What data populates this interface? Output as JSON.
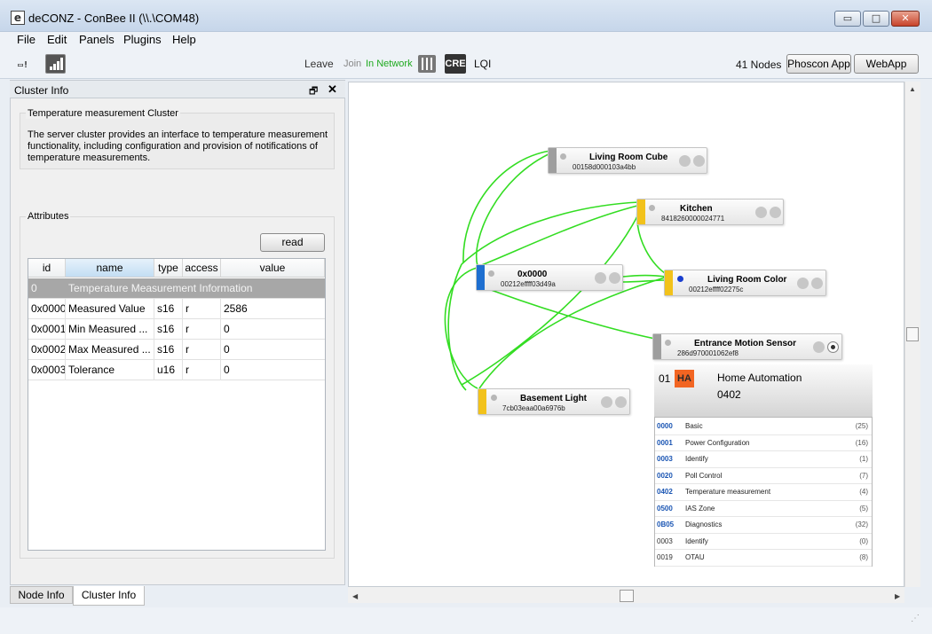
{
  "window": {
    "title": "deCONZ - ConBee II (\\\\.\\COM48)",
    "icon_letter": "e",
    "minimize": "▭",
    "maximize": "□",
    "close": "✕"
  },
  "menu": [
    "File",
    "Edit",
    "Panels",
    "Plugins",
    "Help"
  ],
  "toolbar": {
    "plug_glyph": "▭!",
    "leave": "Leave",
    "join": "Join",
    "network": "In Network",
    "cre": "CRE",
    "lqi": "LQI",
    "nodes": "41 Nodes",
    "phoscon": "Phoscon App",
    "webapp": "WebApp"
  },
  "panel": {
    "title": "Cluster Info",
    "float_glyph": "🗗",
    "close_glyph": "✕",
    "cluster_title": "Temperature measurement Cluster",
    "cluster_desc": "The server cluster provides an interface to temperature measurement functionality, including configuration and provision  of notifications of temperature measurements.",
    "attributes_label": "Attributes",
    "read_button": "read",
    "columns": [
      "id",
      "name",
      "type",
      "access",
      "value"
    ],
    "group_row": {
      "id": "0",
      "name": "Temperature Measurement Information"
    },
    "rows": [
      {
        "id": "0x0000",
        "name": "Measured Value",
        "type": "s16",
        "access": "r",
        "value": "2586"
      },
      {
        "id": "0x0001",
        "name": "Min Measured ...",
        "type": "s16",
        "access": "r",
        "value": "0"
      },
      {
        "id": "0x0002",
        "name": "Max Measured ...",
        "type": "s16",
        "access": "r",
        "value": "0"
      },
      {
        "id": "0x0003",
        "name": "Tolerance",
        "type": "u16",
        "access": "r",
        "value": "0"
      }
    ]
  },
  "tabs": {
    "node_info": "Node Info",
    "cluster_info": "Cluster Info"
  },
  "nodes": [
    {
      "name": "Living Room Cube",
      "address": "00158d000103a4bb",
      "color": "#9e9e9e"
    },
    {
      "name": "Kitchen",
      "address": "8418260000024771",
      "color": "#f2c21b"
    },
    {
      "name": "0x0000",
      "address": "00212effff03d49a",
      "color": "#1e6fd0"
    },
    {
      "name": "Living Room Color",
      "address": "00212effff02275c",
      "color": "#f2c21b"
    },
    {
      "name": "Entrance Motion Sensor",
      "address": "286d970001062ef8",
      "color": "#9e9e9e"
    },
    {
      "name": "Basement Light",
      "address": "7cb03eaa00a6976b",
      "color": "#f2c21b"
    }
  ],
  "colors": {
    "link": "#33dd22",
    "network_text": "#1faa1f",
    "ha_badge": "#f26522",
    "cluster_id": "#1a55b3"
  },
  "endpoint_card": {
    "endpoint": "01",
    "badge": "HA",
    "profile": "Home Automation",
    "device_id": "0402",
    "clusters": [
      {
        "id": "0000",
        "name": "Basic",
        "count": "(25)",
        "server": true
      },
      {
        "id": "0001",
        "name": "Power Configuration",
        "count": "(16)",
        "server": true
      },
      {
        "id": "0003",
        "name": "Identify",
        "count": "(1)",
        "server": true
      },
      {
        "id": "0020",
        "name": "Poll Control",
        "count": "(7)",
        "server": true
      },
      {
        "id": "0402",
        "name": "Temperature measurement",
        "count": "(4)",
        "server": true
      },
      {
        "id": "0500",
        "name": "IAS Zone",
        "count": "(5)",
        "server": true
      },
      {
        "id": "0B05",
        "name": "Diagnostics",
        "count": "(32)",
        "server": true
      },
      {
        "id": "0003",
        "name": "Identify",
        "count": "(0)",
        "server": false
      },
      {
        "id": "0019",
        "name": "OTAU",
        "count": "(8)",
        "server": false
      }
    ]
  },
  "scroll": {
    "up": "▲",
    "left": "◀",
    "right": "▶",
    "grip": "⋰"
  }
}
